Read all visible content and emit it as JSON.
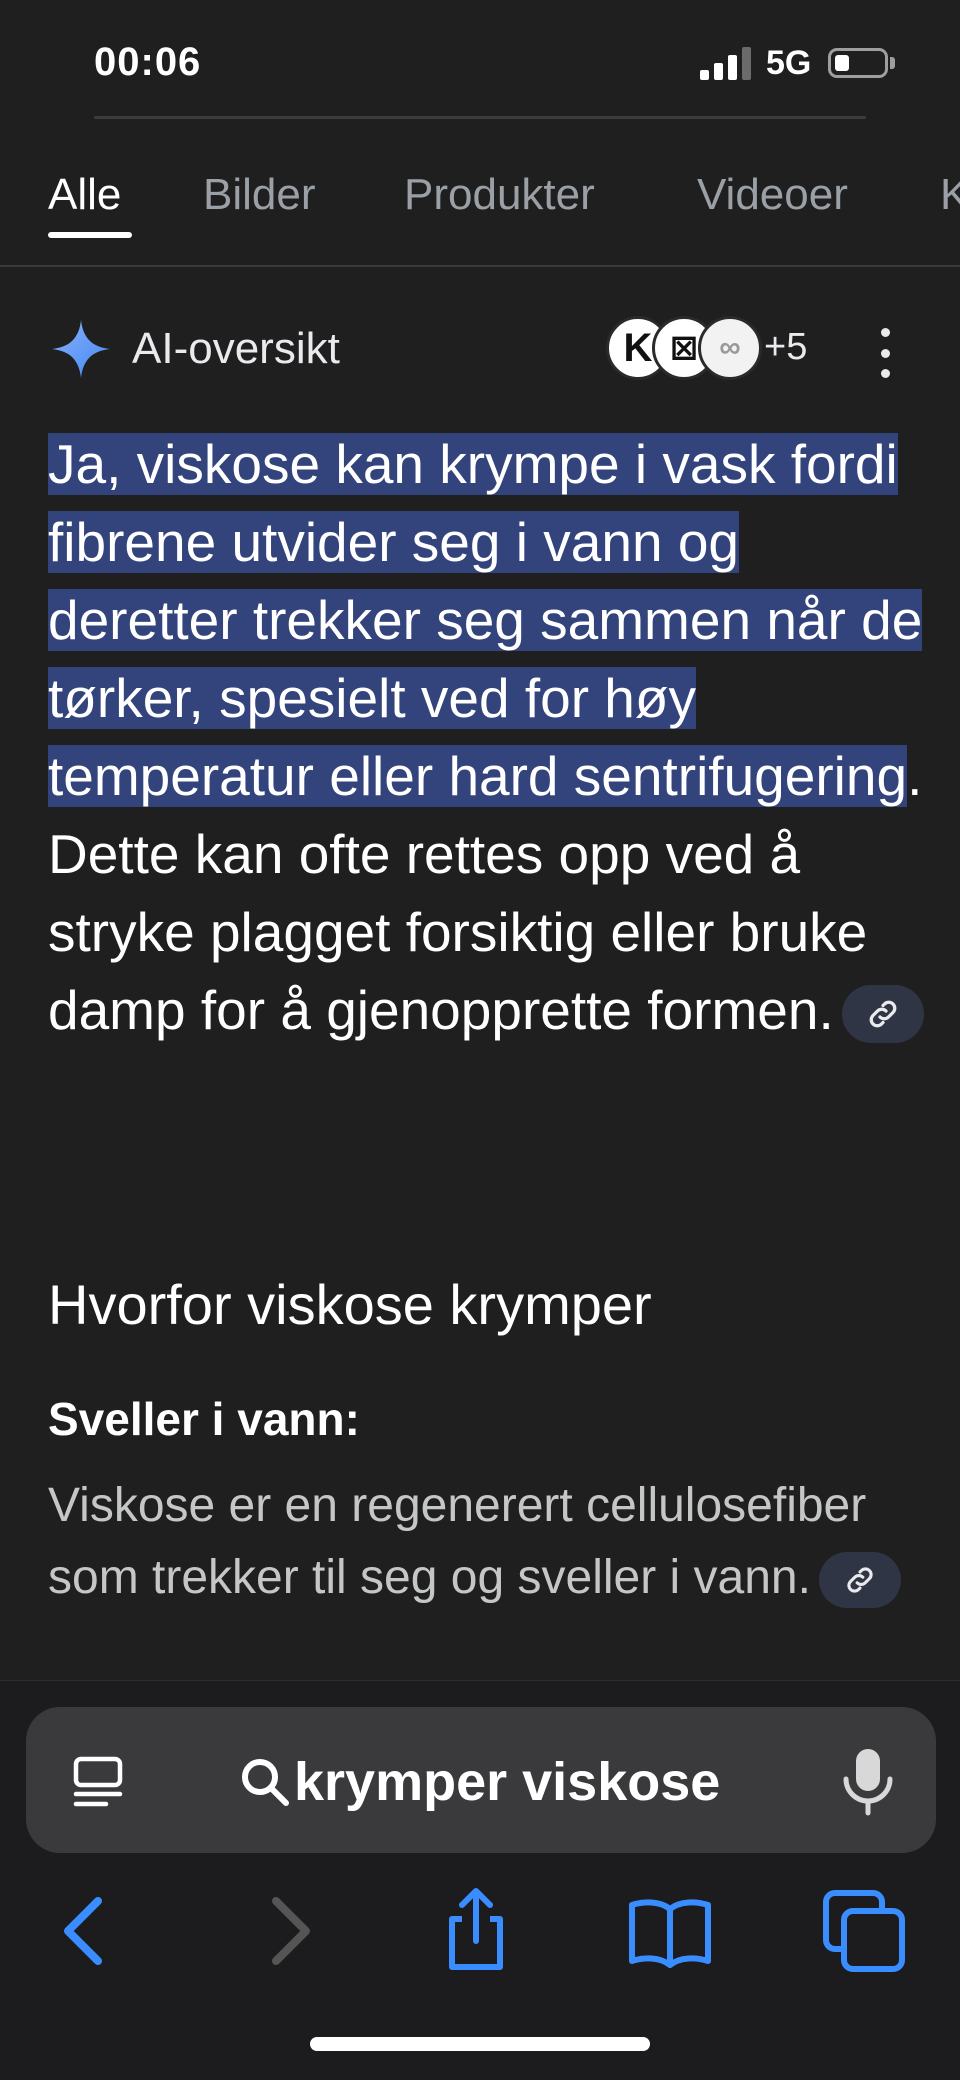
{
  "status": {
    "time": "00:06",
    "network": "5G"
  },
  "tabs": [
    {
      "label": "Alle",
      "active": true
    },
    {
      "label": "Bilder",
      "active": false
    },
    {
      "label": "Produkter",
      "active": false
    },
    {
      "label": "Videoer",
      "active": false
    },
    {
      "label": "K",
      "active": false
    }
  ],
  "ai_overview": {
    "title": "AI-oversikt",
    "sources": [
      "K",
      "⊠",
      "∞"
    ],
    "more_sources": "+5",
    "highlighted_text": "Ja, viskose kan krympe i vask fordi fibrene utvider seg i vann og deretter trekker seg sammen når de tørker, spesielt ved for høy temperatur eller hard sentrifugering",
    "rest_text": ". Dette kan ofte rettes opp ved å stryke plagget forsiktig eller bruke damp for å gjenopprette formen."
  },
  "section": {
    "title": "Hvorfor viskose krymper",
    "subtitle": "Sveller i vann:",
    "text": "Viskose er en regenerert cellulosefiber som trekker til seg og sveller i vann."
  },
  "search": {
    "query": "krymper viskose"
  },
  "icons": {
    "accent": "#3a8dff",
    "highlight": "#33437c",
    "names": [
      "ai-sparkle-icon",
      "link-icon",
      "reader-icon",
      "search-icon",
      "mic-icon",
      "back-icon",
      "forward-icon",
      "share-icon",
      "bookmarks-icon",
      "tabs-icon"
    ]
  }
}
